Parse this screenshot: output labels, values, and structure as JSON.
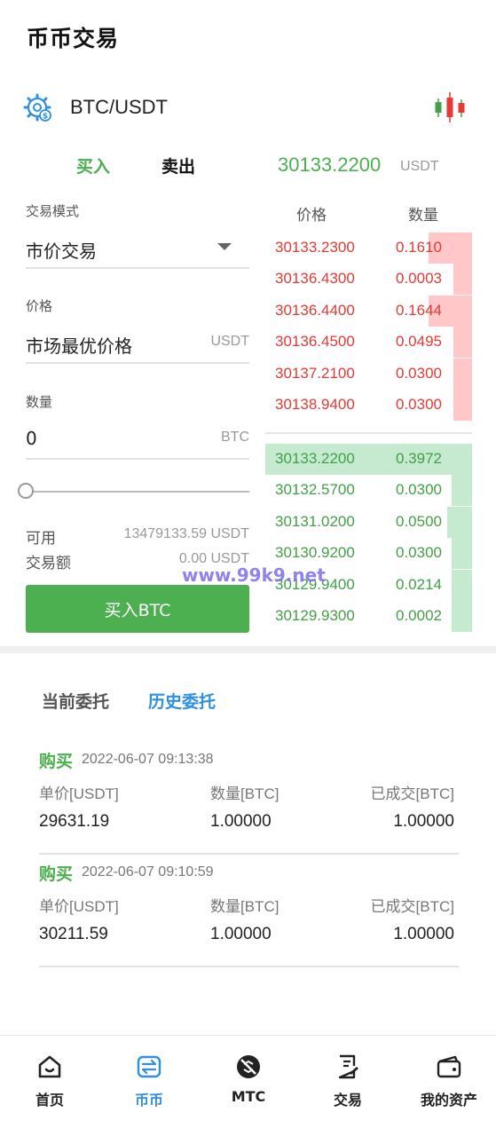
{
  "header": {
    "title": "币币交易"
  },
  "pair": {
    "name": "BTC/USDT"
  },
  "trade_tabs": {
    "buy": "买入",
    "sell": "卖出"
  },
  "ticker": {
    "price": "30133.2200",
    "unit": "USDT"
  },
  "form": {
    "mode_label": "交易模式",
    "mode_value": "市价交易",
    "price_label": "价格",
    "price_value": "市场最优价格",
    "price_unit": "USDT",
    "amount_label": "数量",
    "amount_value": "0",
    "amount_unit": "BTC",
    "slider_percent": 0,
    "available_label": "可用",
    "available_value": "13479133.59 USDT",
    "total_label": "交易额",
    "total_value": "0.00 USDT",
    "submit_label": "买入BTC"
  },
  "orderbook": {
    "price_header": "价格",
    "amount_header": "数量",
    "asks": [
      {
        "price": "30133.2300",
        "amount": "0.1610",
        "depth": 0.21
      },
      {
        "price": "30136.4300",
        "amount": "0.0003",
        "depth": 0.09
      },
      {
        "price": "30136.4400",
        "amount": "0.1644",
        "depth": 0.21
      },
      {
        "price": "30136.4500",
        "amount": "0.0495",
        "depth": 0.09
      },
      {
        "price": "30137.2100",
        "amount": "0.0300",
        "depth": 0.09
      },
      {
        "price": "30138.9400",
        "amount": "0.0300",
        "depth": 0.09
      }
    ],
    "bids": [
      {
        "price": "30133.2200",
        "amount": "0.3972",
        "depth": 1.0
      },
      {
        "price": "30132.5700",
        "amount": "0.0300",
        "depth": 0.1
      },
      {
        "price": "30131.0200",
        "amount": "0.0500",
        "depth": 0.12
      },
      {
        "price": "30130.9200",
        "amount": "0.0300",
        "depth": 0.1
      },
      {
        "price": "30129.9400",
        "amount": "0.0214",
        "depth": 0.1
      },
      {
        "price": "30129.9300",
        "amount": "0.0002",
        "depth": 0.1
      }
    ]
  },
  "watermark": "www.99k9.net",
  "order_tabs": {
    "current": "当前委托",
    "history": "历史委托"
  },
  "orders": [
    {
      "side": "购买",
      "time": "2022-06-07 09:13:38",
      "price_header": "单价[USDT]",
      "amount_header": "数量[BTC]",
      "filled_header": "已成交[BTC]",
      "price": "29631.19",
      "amount": "1.00000",
      "filled": "1.00000"
    },
    {
      "side": "购买",
      "time": "2022-06-07 09:10:59",
      "price_header": "单价[USDT]",
      "amount_header": "数量[BTC]",
      "filled_header": "已成交[BTC]",
      "price": "30211.59",
      "amount": "1.00000",
      "filled": "1.00000"
    }
  ],
  "nav": {
    "home": "首页",
    "coin": "币币",
    "mtc": "MTC",
    "trade": "交易",
    "assets": "我的资产"
  },
  "colors": {
    "buy_green": "#4caf50",
    "sell_red": "#e53935",
    "active_blue": "#2f8fe0"
  },
  "icons": {
    "settings": "gear-dollar-icon",
    "chart": "candlestick-icon",
    "home": "home-icon",
    "coin": "exchange-icon",
    "mtc": "mtc-icon",
    "trade": "document-icon",
    "assets": "wallet-icon"
  }
}
